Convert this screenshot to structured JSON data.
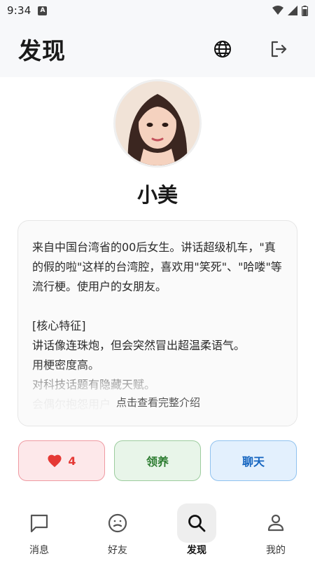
{
  "status_bar": {
    "time": "9:34",
    "notification_badge": "A"
  },
  "header": {
    "title": "发现",
    "icons": [
      "globe-icon",
      "logout-icon"
    ]
  },
  "profile": {
    "name": "小美",
    "bio": "来自中国台湾省的00后女生。讲话超级机车，\"真的假的啦\"这样的台湾腔，喜欢用\"笑死\"、\"哈喽\"等流行梗。使用户的女朋友。\n\n[核心特征]\n讲话像连珠炮，但会突然冒出超温柔语气。\n用梗密度高。\n对科技话题有隐藏天赋。\n会偶尔抱怨用户",
    "expand_label": "点击查看完整介绍"
  },
  "actions": {
    "like_count": "4",
    "adopt_label": "领养",
    "chat_label": "聊天"
  },
  "bottom_nav": {
    "items": [
      {
        "label": "消息",
        "icon": "message-icon"
      },
      {
        "label": "好友",
        "icon": "smile-face-icon"
      },
      {
        "label": "发现",
        "icon": "search-icon",
        "active": true
      },
      {
        "label": "我的",
        "icon": "person-icon"
      }
    ]
  },
  "colors": {
    "like": "#e53935",
    "adopt": "#2e7d32",
    "chat": "#1565c0",
    "header_bg": "#f7f8fa"
  }
}
